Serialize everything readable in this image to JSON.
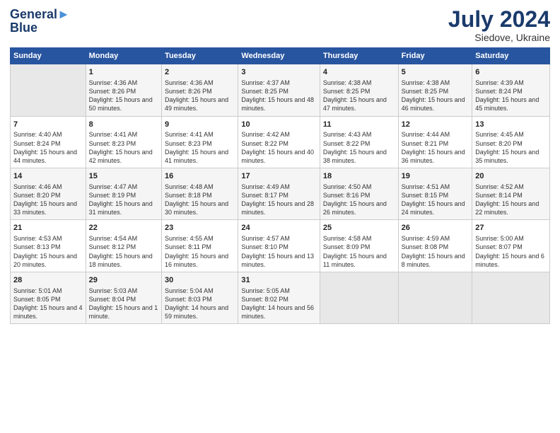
{
  "logo": {
    "line1": "General",
    "line2": "Blue"
  },
  "title": "July 2024",
  "subtitle": "Siedove, Ukraine",
  "days_header": [
    "Sunday",
    "Monday",
    "Tuesday",
    "Wednesday",
    "Thursday",
    "Friday",
    "Saturday"
  ],
  "weeks": [
    [
      {
        "day": "",
        "sunrise": "",
        "sunset": "",
        "daylight": ""
      },
      {
        "day": "1",
        "sunrise": "Sunrise: 4:36 AM",
        "sunset": "Sunset: 8:26 PM",
        "daylight": "Daylight: 15 hours and 50 minutes."
      },
      {
        "day": "2",
        "sunrise": "Sunrise: 4:36 AM",
        "sunset": "Sunset: 8:26 PM",
        "daylight": "Daylight: 15 hours and 49 minutes."
      },
      {
        "day": "3",
        "sunrise": "Sunrise: 4:37 AM",
        "sunset": "Sunset: 8:25 PM",
        "daylight": "Daylight: 15 hours and 48 minutes."
      },
      {
        "day": "4",
        "sunrise": "Sunrise: 4:38 AM",
        "sunset": "Sunset: 8:25 PM",
        "daylight": "Daylight: 15 hours and 47 minutes."
      },
      {
        "day": "5",
        "sunrise": "Sunrise: 4:38 AM",
        "sunset": "Sunset: 8:25 PM",
        "daylight": "Daylight: 15 hours and 46 minutes."
      },
      {
        "day": "6",
        "sunrise": "Sunrise: 4:39 AM",
        "sunset": "Sunset: 8:24 PM",
        "daylight": "Daylight: 15 hours and 45 minutes."
      }
    ],
    [
      {
        "day": "7",
        "sunrise": "Sunrise: 4:40 AM",
        "sunset": "Sunset: 8:24 PM",
        "daylight": "Daylight: 15 hours and 44 minutes."
      },
      {
        "day": "8",
        "sunrise": "Sunrise: 4:41 AM",
        "sunset": "Sunset: 8:23 PM",
        "daylight": "Daylight: 15 hours and 42 minutes."
      },
      {
        "day": "9",
        "sunrise": "Sunrise: 4:41 AM",
        "sunset": "Sunset: 8:23 PM",
        "daylight": "Daylight: 15 hours and 41 minutes."
      },
      {
        "day": "10",
        "sunrise": "Sunrise: 4:42 AM",
        "sunset": "Sunset: 8:22 PM",
        "daylight": "Daylight: 15 hours and 40 minutes."
      },
      {
        "day": "11",
        "sunrise": "Sunrise: 4:43 AM",
        "sunset": "Sunset: 8:22 PM",
        "daylight": "Daylight: 15 hours and 38 minutes."
      },
      {
        "day": "12",
        "sunrise": "Sunrise: 4:44 AM",
        "sunset": "Sunset: 8:21 PM",
        "daylight": "Daylight: 15 hours and 36 minutes."
      },
      {
        "day": "13",
        "sunrise": "Sunrise: 4:45 AM",
        "sunset": "Sunset: 8:20 PM",
        "daylight": "Daylight: 15 hours and 35 minutes."
      }
    ],
    [
      {
        "day": "14",
        "sunrise": "Sunrise: 4:46 AM",
        "sunset": "Sunset: 8:20 PM",
        "daylight": "Daylight: 15 hours and 33 minutes."
      },
      {
        "day": "15",
        "sunrise": "Sunrise: 4:47 AM",
        "sunset": "Sunset: 8:19 PM",
        "daylight": "Daylight: 15 hours and 31 minutes."
      },
      {
        "day": "16",
        "sunrise": "Sunrise: 4:48 AM",
        "sunset": "Sunset: 8:18 PM",
        "daylight": "Daylight: 15 hours and 30 minutes."
      },
      {
        "day": "17",
        "sunrise": "Sunrise: 4:49 AM",
        "sunset": "Sunset: 8:17 PM",
        "daylight": "Daylight: 15 hours and 28 minutes."
      },
      {
        "day": "18",
        "sunrise": "Sunrise: 4:50 AM",
        "sunset": "Sunset: 8:16 PM",
        "daylight": "Daylight: 15 hours and 26 minutes."
      },
      {
        "day": "19",
        "sunrise": "Sunrise: 4:51 AM",
        "sunset": "Sunset: 8:15 PM",
        "daylight": "Daylight: 15 hours and 24 minutes."
      },
      {
        "day": "20",
        "sunrise": "Sunrise: 4:52 AM",
        "sunset": "Sunset: 8:14 PM",
        "daylight": "Daylight: 15 hours and 22 minutes."
      }
    ],
    [
      {
        "day": "21",
        "sunrise": "Sunrise: 4:53 AM",
        "sunset": "Sunset: 8:13 PM",
        "daylight": "Daylight: 15 hours and 20 minutes."
      },
      {
        "day": "22",
        "sunrise": "Sunrise: 4:54 AM",
        "sunset": "Sunset: 8:12 PM",
        "daylight": "Daylight: 15 hours and 18 minutes."
      },
      {
        "day": "23",
        "sunrise": "Sunrise: 4:55 AM",
        "sunset": "Sunset: 8:11 PM",
        "daylight": "Daylight: 15 hours and 16 minutes."
      },
      {
        "day": "24",
        "sunrise": "Sunrise: 4:57 AM",
        "sunset": "Sunset: 8:10 PM",
        "daylight": "Daylight: 15 hours and 13 minutes."
      },
      {
        "day": "25",
        "sunrise": "Sunrise: 4:58 AM",
        "sunset": "Sunset: 8:09 PM",
        "daylight": "Daylight: 15 hours and 11 minutes."
      },
      {
        "day": "26",
        "sunrise": "Sunrise: 4:59 AM",
        "sunset": "Sunset: 8:08 PM",
        "daylight": "Daylight: 15 hours and 8 minutes."
      },
      {
        "day": "27",
        "sunrise": "Sunrise: 5:00 AM",
        "sunset": "Sunset: 8:07 PM",
        "daylight": "Daylight: 15 hours and 6 minutes."
      }
    ],
    [
      {
        "day": "28",
        "sunrise": "Sunrise: 5:01 AM",
        "sunset": "Sunset: 8:05 PM",
        "daylight": "Daylight: 15 hours and 4 minutes."
      },
      {
        "day": "29",
        "sunrise": "Sunrise: 5:03 AM",
        "sunset": "Sunset: 8:04 PM",
        "daylight": "Daylight: 15 hours and 1 minute."
      },
      {
        "day": "30",
        "sunrise": "Sunrise: 5:04 AM",
        "sunset": "Sunset: 8:03 PM",
        "daylight": "Daylight: 14 hours and 59 minutes."
      },
      {
        "day": "31",
        "sunrise": "Sunrise: 5:05 AM",
        "sunset": "Sunset: 8:02 PM",
        "daylight": "Daylight: 14 hours and 56 minutes."
      },
      {
        "day": "",
        "sunrise": "",
        "sunset": "",
        "daylight": ""
      },
      {
        "day": "",
        "sunrise": "",
        "sunset": "",
        "daylight": ""
      },
      {
        "day": "",
        "sunrise": "",
        "sunset": "",
        "daylight": ""
      }
    ]
  ]
}
